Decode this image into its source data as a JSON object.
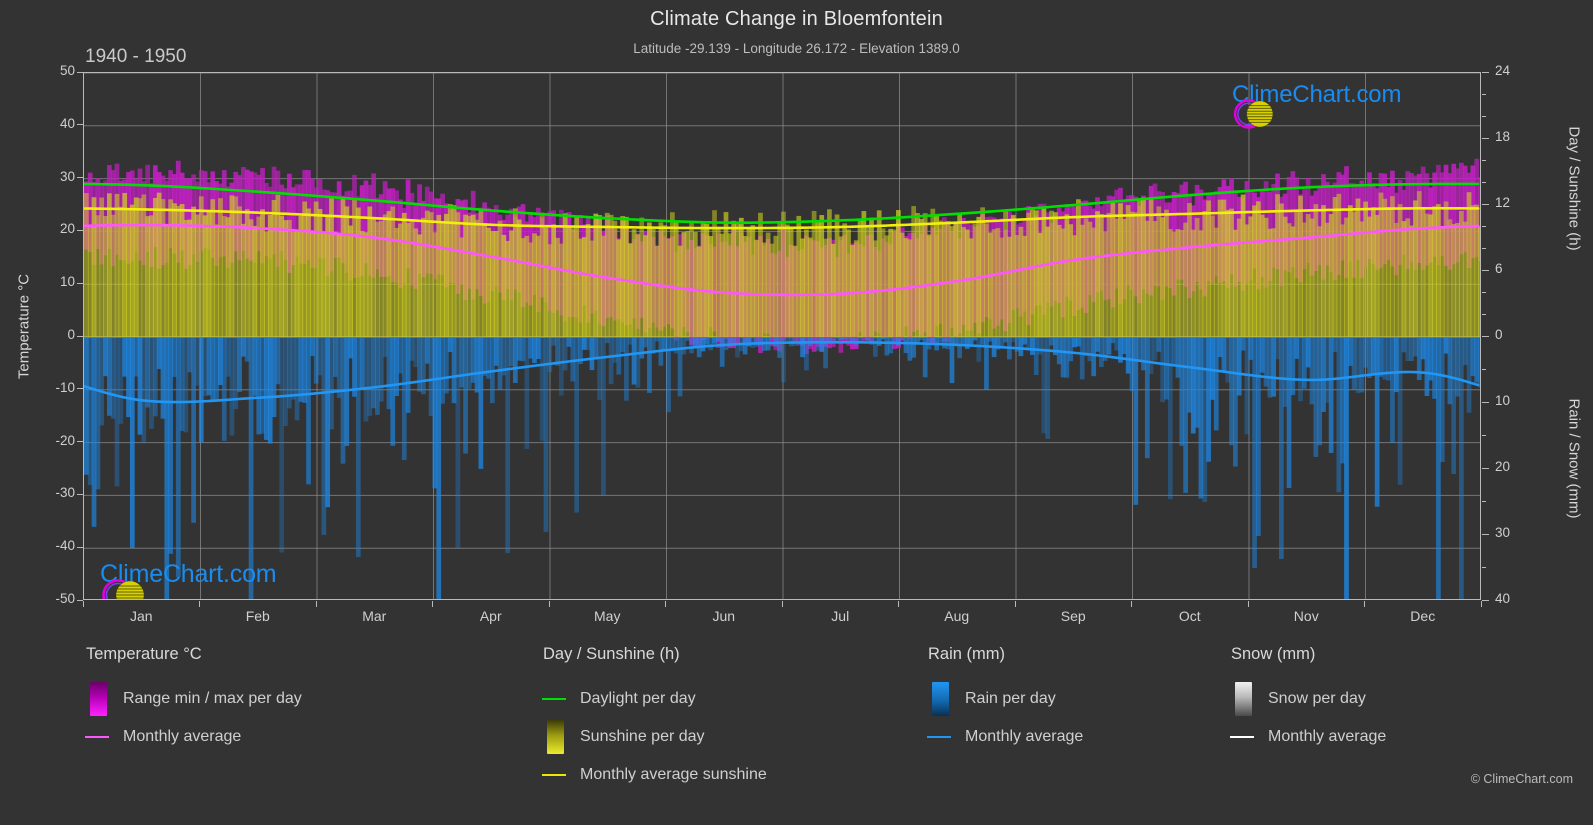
{
  "header": {
    "title": "Climate Change in Bloemfontein",
    "subtitle": "Latitude -29.139 - Longitude 26.172 - Elevation 1389.0",
    "period": "1940 - 1950"
  },
  "axes": {
    "left_title": "Temperature °C",
    "right_top_title": "Day / Sunshine (h)",
    "right_bottom_title": "Rain / Snow (mm)",
    "left_ticks": [
      "50",
      "40",
      "30",
      "20",
      "10",
      "0",
      "-10",
      "-20",
      "-30",
      "-40",
      "-50"
    ],
    "right_top_ticks": [
      "24",
      "18",
      "12",
      "6",
      "0"
    ],
    "right_bottom_ticks": [
      "0",
      "10",
      "20",
      "30",
      "40"
    ],
    "x_ticks": [
      "Jan",
      "Feb",
      "Mar",
      "Apr",
      "May",
      "Jun",
      "Jul",
      "Aug",
      "Sep",
      "Oct",
      "Nov",
      "Dec"
    ]
  },
  "legend": {
    "temperature": {
      "heading": "Temperature °C",
      "items": [
        {
          "label": "Range min / max per day",
          "swatch": "gradient-magenta",
          "type": "box"
        },
        {
          "label": "Monthly average",
          "swatch": "#ff55ff",
          "type": "line"
        }
      ]
    },
    "daysun": {
      "heading": "Day / Sunshine (h)",
      "items": [
        {
          "label": "Daylight per day",
          "swatch": "#00e000",
          "type": "line"
        },
        {
          "label": "Sunshine per day",
          "swatch": "gradient-yellow",
          "type": "box"
        },
        {
          "label": "Monthly average sunshine",
          "swatch": "#e8e80a",
          "type": "line"
        }
      ]
    },
    "rain": {
      "heading": "Rain (mm)",
      "items": [
        {
          "label": "Rain per day",
          "swatch": "gradient-blue",
          "type": "box"
        },
        {
          "label": "Monthly average",
          "swatch": "#2196f3",
          "type": "line"
        }
      ]
    },
    "snow": {
      "heading": "Snow (mm)",
      "items": [
        {
          "label": "Snow per day",
          "swatch": "gradient-white",
          "type": "box"
        },
        {
          "label": "Monthly average",
          "swatch": "#ffffff",
          "type": "line"
        }
      ]
    }
  },
  "watermark": {
    "text": "ClimeChart.com",
    "copyright": "© ClimeChart.com"
  },
  "colors": {
    "background": "#333333",
    "grid": "#8a8a8a",
    "axis": "#b9b9b9",
    "temp_range": "#cc00cc",
    "temp_avg": "#ff55ff",
    "daylight": "#00e000",
    "sunshine": "#c8c818",
    "sunshine_avg": "#e8e80a",
    "rain": "#1e88e5",
    "rain_avg": "#2196f3",
    "snow": "#ffffff",
    "logo_blue": "#1a8cf0",
    "logo_magenta": "#e000e0",
    "logo_yellow": "#d8d000"
  },
  "chart_data": {
    "type": "area",
    "title": "Climate Change in Bloemfontein",
    "subtitle": "Latitude -29.139 - Longitude 26.172 - Elevation 1389.0",
    "period": "1940 - 1950",
    "xlabel": "",
    "ylabel": "Temperature °C",
    "ylabel_right_top": "Day / Sunshine (h)",
    "ylabel_right_bottom": "Rain / Snow (mm)",
    "ylim": [
      -50,
      50
    ],
    "ylim_right_top": [
      0,
      24
    ],
    "ylim_right_bottom": [
      0,
      40
    ],
    "grid": true,
    "legend_position": "below",
    "categories": [
      "Jan",
      "Feb",
      "Mar",
      "Apr",
      "May",
      "Jun",
      "Jul",
      "Aug",
      "Sep",
      "Oct",
      "Nov",
      "Dec"
    ],
    "series": [
      {
        "name": "Monthly average temperature (°C)",
        "unit": "°C",
        "color": "#ff55ff",
        "values": [
          21.2,
          20.6,
          18.8,
          15.2,
          11.2,
          8.4,
          8.2,
          10.6,
          14.6,
          17.0,
          18.8,
          20.6
        ]
      },
      {
        "name": "Daily max temperature (°C)",
        "unit": "°C",
        "color": "#cc00cc",
        "values": [
          31.0,
          30.0,
          28.0,
          24.5,
          21.0,
          18.0,
          18.0,
          21.0,
          25.0,
          27.5,
          29.0,
          30.5
        ]
      },
      {
        "name": "Daily min temperature (°C)",
        "unit": "°C",
        "color": "#cc00cc",
        "values": [
          15.0,
          14.5,
          12.0,
          8.0,
          3.0,
          -0.5,
          -1.0,
          1.5,
          6.0,
          9.5,
          12.0,
          14.0
        ]
      },
      {
        "name": "Daylight per day (h)",
        "unit": "h",
        "color": "#00e000",
        "values": [
          13.8,
          13.2,
          12.4,
          11.5,
          10.8,
          10.4,
          10.6,
          11.2,
          12.0,
          12.9,
          13.6,
          13.9
        ]
      },
      {
        "name": "Monthly average sunshine (h)",
        "unit": "h",
        "color": "#e8e80a",
        "values": [
          11.6,
          11.3,
          10.8,
          10.2,
          10.0,
          9.9,
          10.0,
          10.4,
          10.9,
          11.2,
          11.5,
          11.7
        ]
      },
      {
        "name": "Monthly average rain (mm)",
        "unit": "mm",
        "color": "#2196f3",
        "values": [
          9.6,
          9.2,
          7.6,
          5.2,
          3.0,
          1.2,
          0.8,
          1.2,
          2.4,
          4.6,
          6.5,
          5.4
        ]
      }
    ],
    "annotations": [
      "ClimeChart.com",
      "© ClimeChart.com"
    ]
  }
}
